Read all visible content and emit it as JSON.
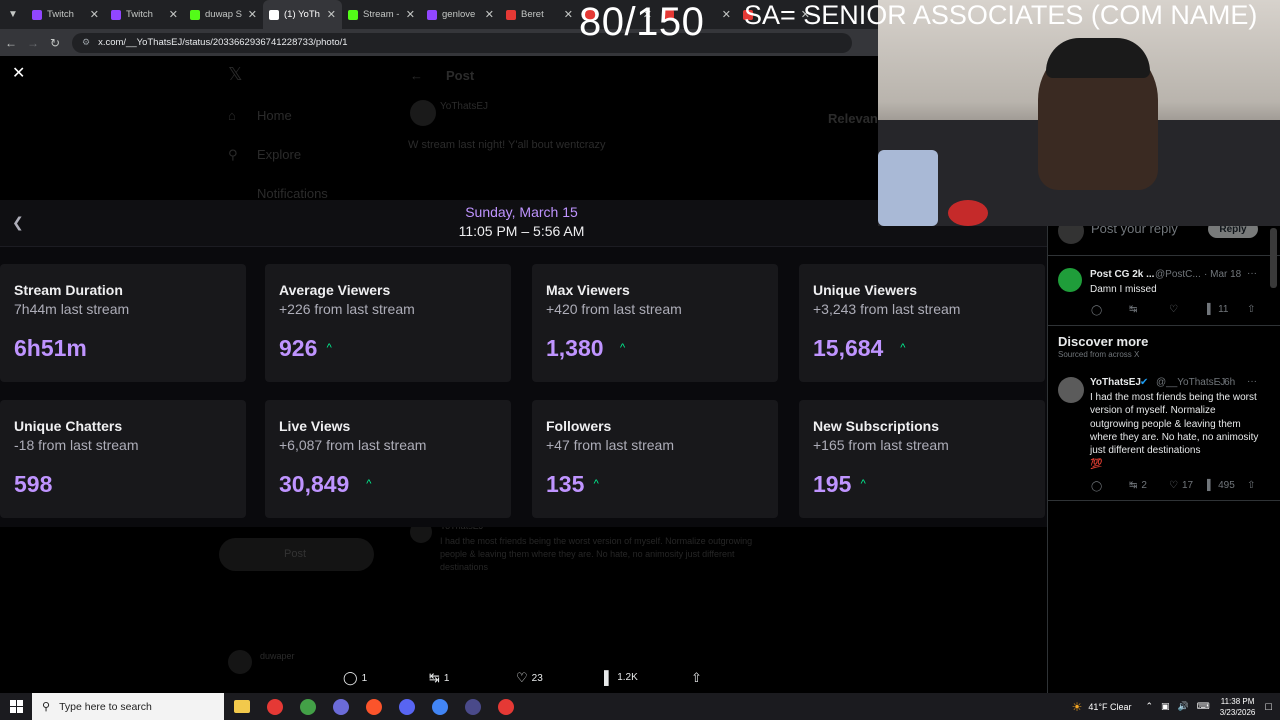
{
  "browser": {
    "tabs": [
      {
        "title": "Twitch",
        "color": "#9146ff",
        "active": false
      },
      {
        "title": "Twitch",
        "color": "#9146ff",
        "active": false
      },
      {
        "title": "duwap S",
        "color": "#53fc18",
        "active": false
      },
      {
        "title": "(1) YoTh",
        "color": "#ffffff",
        "active": true
      },
      {
        "title": "Stream -",
        "color": "#53fc18",
        "active": false
      },
      {
        "title": "genlove",
        "color": "#9146ff",
        "active": false
      },
      {
        "title": "Beret",
        "color": "#e53935",
        "active": false
      },
      {
        "title": "",
        "color": "#e53935",
        "active": false
      },
      {
        "title": "",
        "color": "#e53935",
        "active": false
      },
      {
        "title": "",
        "color": "#e53935",
        "active": false
      }
    ],
    "url": "x.com/__YoThatsEJ/status/2033662936741228733/photo/1"
  },
  "overlay": {
    "counter": "80/150",
    "banner": "SA= SENIOR ASSOCIATES (COM NAME)"
  },
  "ghost": {
    "post_header": "Post",
    "post_text": "W stream last night! Y'all bout wentcrazy",
    "relevant": "Relevant",
    "nav_home": "Home",
    "nav_explore": "Explore",
    "nav_notifications": "Notifications",
    "post_btn": "Post",
    "reply_user": "YoThatsEJ",
    "reply_user2": "duwaper"
  },
  "dashboard": {
    "date": "Sunday, March 15",
    "time": "11:05 PM – 5:56 AM",
    "cards": [
      {
        "label": "Stream Duration",
        "sub": "7h44m last stream",
        "value": "6h51m",
        "up": false
      },
      {
        "label": "Average Viewers",
        "sub": "+226 from last stream",
        "value": "926",
        "up": true
      },
      {
        "label": "Max Viewers",
        "sub": "+420 from last stream",
        "value": "1,380",
        "up": true
      },
      {
        "label": "Unique Viewers",
        "sub": "+3,243 from last stream",
        "value": "15,684",
        "up": true
      },
      {
        "label": "Unique Chatters",
        "sub": "-18 from last stream",
        "value": "598",
        "up": false
      },
      {
        "label": "Live Views",
        "sub": "+6,087 from last stream",
        "value": "30,849",
        "up": true
      },
      {
        "label": "Followers",
        "sub": "+47 from last stream",
        "value": "135",
        "up": true
      },
      {
        "label": "New Subscriptions",
        "sub": "+165 from last stream",
        "value": "195",
        "up": true
      }
    ],
    "up_glyph": "^"
  },
  "post_actions": {
    "replies": "1",
    "reposts": "1",
    "likes": "23",
    "views": "1.2K"
  },
  "right_panel": {
    "reply_placeholder": "Post your reply",
    "reply_button": "Reply",
    "tweet1": {
      "name": "Post CG 2k ...",
      "handle": "@PostC...",
      "date": "· Mar 18",
      "text": "Damn I missed",
      "views": "11"
    },
    "discover_title": "Discover more",
    "discover_sub": "Sourced from across X",
    "tweet2": {
      "name": "YoThatsEJ",
      "handle": "@__YoThatsEJ",
      "date": "· 6h",
      "text": "I had the most friends being the worst version of myself. Normalize outgrowing people & leaving them where they are. No hate, no animosity just different destinations",
      "emoji": "💯",
      "reposts": "2",
      "likes": "17",
      "views": "495"
    }
  },
  "taskbar": {
    "search_placeholder": "Type here to search",
    "weather": "41°F Clear",
    "time": "11:38 PM",
    "date": "3/23/2026",
    "app_colors": [
      "#f2c94c",
      "#e53935",
      "#43a047",
      "#6b6bd8",
      "#fb542b",
      "#5865f2",
      "#4285f4",
      "#4a4a8a",
      "#e53935"
    ]
  }
}
